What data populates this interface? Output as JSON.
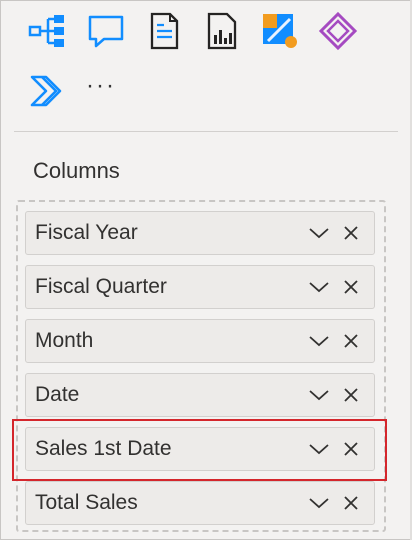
{
  "toolbar": {
    "icons": [
      {
        "name": "decomposition-tree-icon"
      },
      {
        "name": "qa-bubble-icon"
      },
      {
        "name": "smart-narrative-icon"
      },
      {
        "name": "paginated-report-icon"
      },
      {
        "name": "power-automate-icon"
      },
      {
        "name": "power-apps-icon"
      },
      {
        "name": "power-automate-chevron-icon"
      }
    ],
    "more_label": "···"
  },
  "section": {
    "title": "Columns"
  },
  "fields": [
    {
      "label": "Fiscal Year"
    },
    {
      "label": "Fiscal Quarter"
    },
    {
      "label": "Month"
    },
    {
      "label": "Date"
    },
    {
      "label": "Sales 1st Date",
      "highlighted": true
    },
    {
      "label": "Total Sales"
    }
  ],
  "colors": {
    "accent_blue": "#118dff",
    "highlight_red": "#d4262c",
    "power_apps_purple": "#a54ac1",
    "power_automate_orange": "#f29c1f"
  }
}
